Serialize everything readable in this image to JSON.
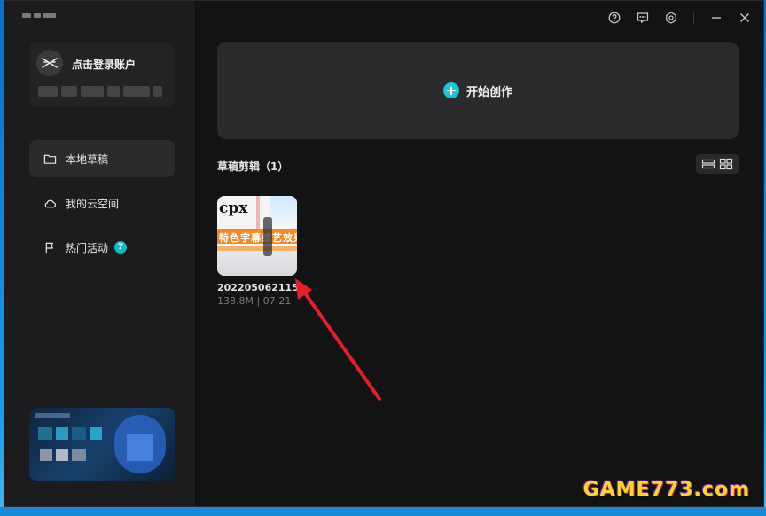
{
  "sidebar": {
    "account": {
      "login_label": "点击登录账户"
    },
    "nav": [
      {
        "id": "local",
        "label": "本地草稿",
        "icon": "folder-icon",
        "active": true
      },
      {
        "id": "cloud",
        "label": "我的云空间",
        "icon": "cloud-icon",
        "active": false
      },
      {
        "id": "events",
        "label": "热门活动",
        "icon": "flag-icon",
        "active": false,
        "badge": "7"
      }
    ]
  },
  "header": {
    "controls": [
      "help-icon",
      "feedback-icon",
      "settings-icon",
      "minimize-icon",
      "close-icon"
    ]
  },
  "main": {
    "create_label": "开始创作",
    "drafts_title": "草稿剪辑（1）",
    "drafts": [
      {
        "name": "202205062115",
        "meta": "138.8M | 07:21",
        "thumb_title": "cpx",
        "thumb_band_text": "特色字幕综艺效果"
      }
    ]
  },
  "watermark": {
    "text": "GAME773.com"
  },
  "colors": {
    "accent": "#1fc3d1",
    "badge": "#14b9c9",
    "arrow": "#e0202a",
    "sidebar_bg": "#1c1c1e",
    "main_bg": "#131313"
  }
}
